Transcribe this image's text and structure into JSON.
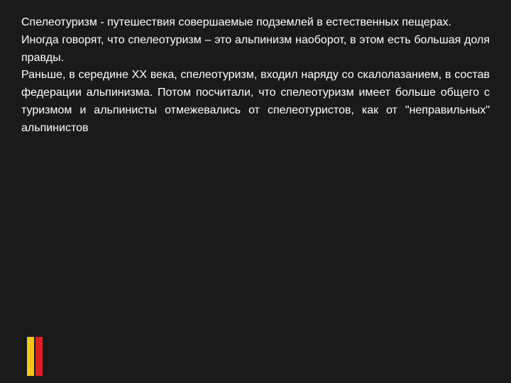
{
  "slide": {
    "background_color": "#1a1a1a",
    "text_color": "#ffffff",
    "main_paragraph": "Спелеотуризм - путешествия совершаемые подземлей в естественных пещерах.\nИногда говорят, что спелеотуризм – это альпинизм наоборот, в этом есть большая доля правды.\nРаньше, в середине XX века, спелеотуризм, входил наряду со скалолазанием, в состав федерации альпинизма. Потом посчитали, что спелеотуризм имеет больше общего с туризмом и альпинисты отмежевались от спелеотуристов, как от \"неправильных\" альпинистов",
    "accent_yellow": "#f5c518",
    "accent_red": "#e02020"
  }
}
